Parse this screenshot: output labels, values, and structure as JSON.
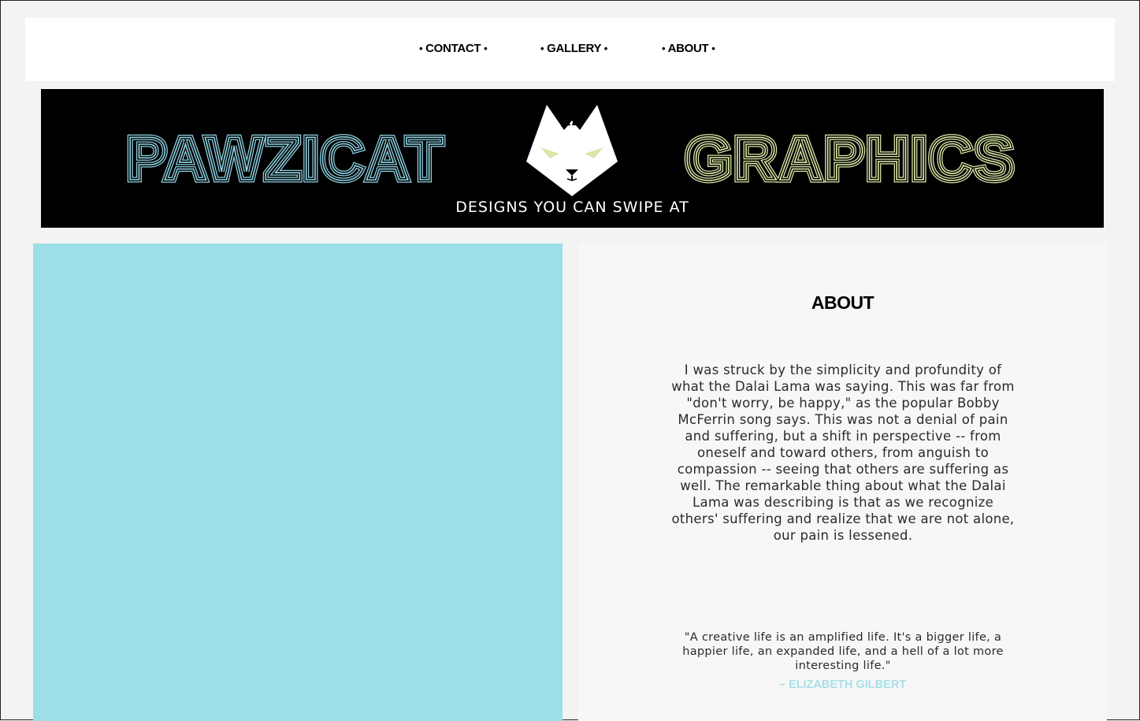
{
  "nav": {
    "items": [
      {
        "label": "CONTACT"
      },
      {
        "label": "GALLERY"
      },
      {
        "label": "ABOUT"
      }
    ],
    "dot": "•"
  },
  "banner": {
    "word_left": "PAWZICAT",
    "word_right": "GRAPHICS",
    "tagline": "DESIGNS YOU CAN SWIPE AT",
    "logo_icon": "cat-face-icon",
    "color_left": "#8fd3e3",
    "color_right": "#d9e8a8"
  },
  "about": {
    "title": "ABOUT",
    "body": "I was struck by the simplicity and profundity of what the Dalai Lama was saying. This was far from \"don't worry, be happy,\" as the popular Bobby McFerrin song says. This was not a denial of pain and suffering, but a shift in perspective -- from oneself and toward others, from anguish to compassion -- seeing that others are suffering as well. The remarkable thing about what the Dalai Lama was describing is that as we recognize others' suffering and realize that we are not alone, our pain is lessened.",
    "quote": "\"A creative life is an amplified life. It's a bigger life, a happier life, an expanded life, and a hell of a lot more interesting life.\"",
    "quote_author": "– ELIZABETH GILBERT"
  },
  "colors": {
    "left_panel": "#9ddfe8",
    "author_accent": "#a9dfe8"
  }
}
